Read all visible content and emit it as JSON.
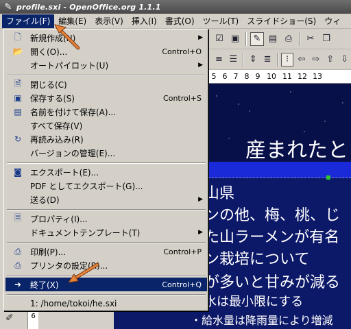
{
  "window": {
    "title": "profile.sxi - OpenOffice.org 1.1.1"
  },
  "menubar": {
    "items": [
      {
        "label": "ファイル(F)"
      },
      {
        "label": "編集(E)"
      },
      {
        "label": "表示(V)"
      },
      {
        "label": "挿入(I)"
      },
      {
        "label": "書式(O)"
      },
      {
        "label": "ツール(T)"
      },
      {
        "label": "スライドショー(S)"
      },
      {
        "label": "ウィ"
      }
    ]
  },
  "file_menu": {
    "items": [
      {
        "label": "新規作成(N)",
        "accel": "",
        "icon": "new-document-icon"
      },
      {
        "label": "開く(O)...",
        "accel": "Control+O",
        "icon": "open-folder-icon"
      },
      {
        "label": "オートパイロット(U)",
        "accel": "",
        "icon": ""
      },
      {
        "label": "閉じる(C)",
        "accel": "",
        "icon": "close-document-icon"
      },
      {
        "label": "保存する(S)",
        "accel": "Control+S",
        "icon": "save-icon"
      },
      {
        "label": "名前を付けて保存(A)...",
        "accel": "",
        "icon": "save-as-icon"
      },
      {
        "label": "すべて保存(V)",
        "accel": "",
        "icon": ""
      },
      {
        "label": "再読み込み(R)",
        "accel": "",
        "icon": "reload-icon"
      },
      {
        "label": "バージョンの管理(E)...",
        "accel": "",
        "icon": ""
      },
      {
        "label": "エクスポート(E)...",
        "accel": "",
        "icon": "export-icon"
      },
      {
        "label": "PDF としてエクスポート(G)...",
        "accel": "",
        "icon": ""
      },
      {
        "label": "送る(D)",
        "accel": "",
        "icon": ""
      },
      {
        "label": "プロパティ(I)...",
        "accel": "",
        "icon": "properties-icon"
      },
      {
        "label": "ドキュメントテンプレート(T)",
        "accel": "",
        "icon": ""
      },
      {
        "label": "印刷(P)...",
        "accel": "Control+P",
        "icon": "print-icon"
      },
      {
        "label": "プリンタの設定(R)...",
        "accel": "",
        "icon": "printer-settings-icon"
      },
      {
        "label": "終了(X)",
        "accel": "Control+Q",
        "icon": "exit-icon"
      },
      {
        "label": "1: /home/tokoi/he.sxi",
        "accel": "",
        "icon": ""
      }
    ]
  },
  "ruler": {
    "ticks": [
      "5",
      "6",
      "7",
      "8",
      "9",
      "10",
      "11",
      "12",
      "13"
    ]
  },
  "slide": {
    "title": "産まれたと",
    "lines": [
      "山県",
      "ンの他、梅、桃、じ",
      "た山ラーメンが有名",
      "ン栽培について",
      "が多いと甘みが減る",
      "水は最小限にする"
    ],
    "footer_line": "・給水量は降雨量により増減"
  },
  "bottom": {
    "paper_label": "6"
  },
  "colors": {
    "menu_highlight": "#0a246a",
    "slide_background": "#08104a",
    "slide_bar": "#1a2ad8",
    "annotation_arrow": "#e8843a"
  }
}
